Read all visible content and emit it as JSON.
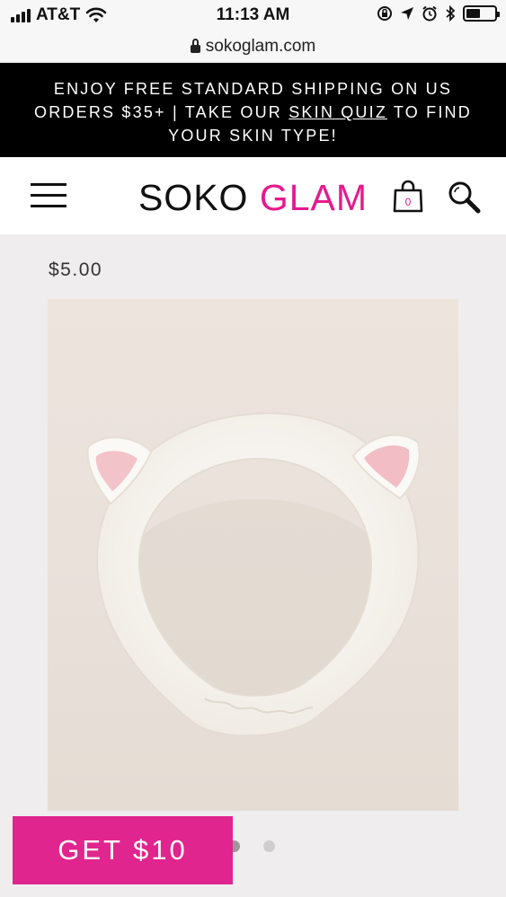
{
  "status_bar": {
    "carrier": "AT&T",
    "time": "11:13 AM"
  },
  "browser": {
    "url": "sokoglam.com"
  },
  "promo": {
    "text_1": "ENJOY FREE STANDARD SHIPPING ON US ORDERS $35+ | TAKE OUR ",
    "link": "SKIN QUIZ",
    "text_2": " TO FIND YOUR SKIN TYPE!"
  },
  "header": {
    "logo_word_1": "SOKO",
    "logo_word_2": "GLAM",
    "bag_count": "0",
    "icons": [
      "menu-icon",
      "shopping-bag-icon",
      "search-icon"
    ]
  },
  "product": {
    "price": "$5.00",
    "image_alt": "White cat-ear headband with pink inner ears",
    "carousel_count": 2,
    "carousel_active": 0
  },
  "cta": {
    "label": "GET $10"
  },
  "colors": {
    "brand_pink": "#e51a8d",
    "cta_pink": "#e0258e",
    "banner_black": "#000000",
    "page_bg": "#efedee"
  }
}
